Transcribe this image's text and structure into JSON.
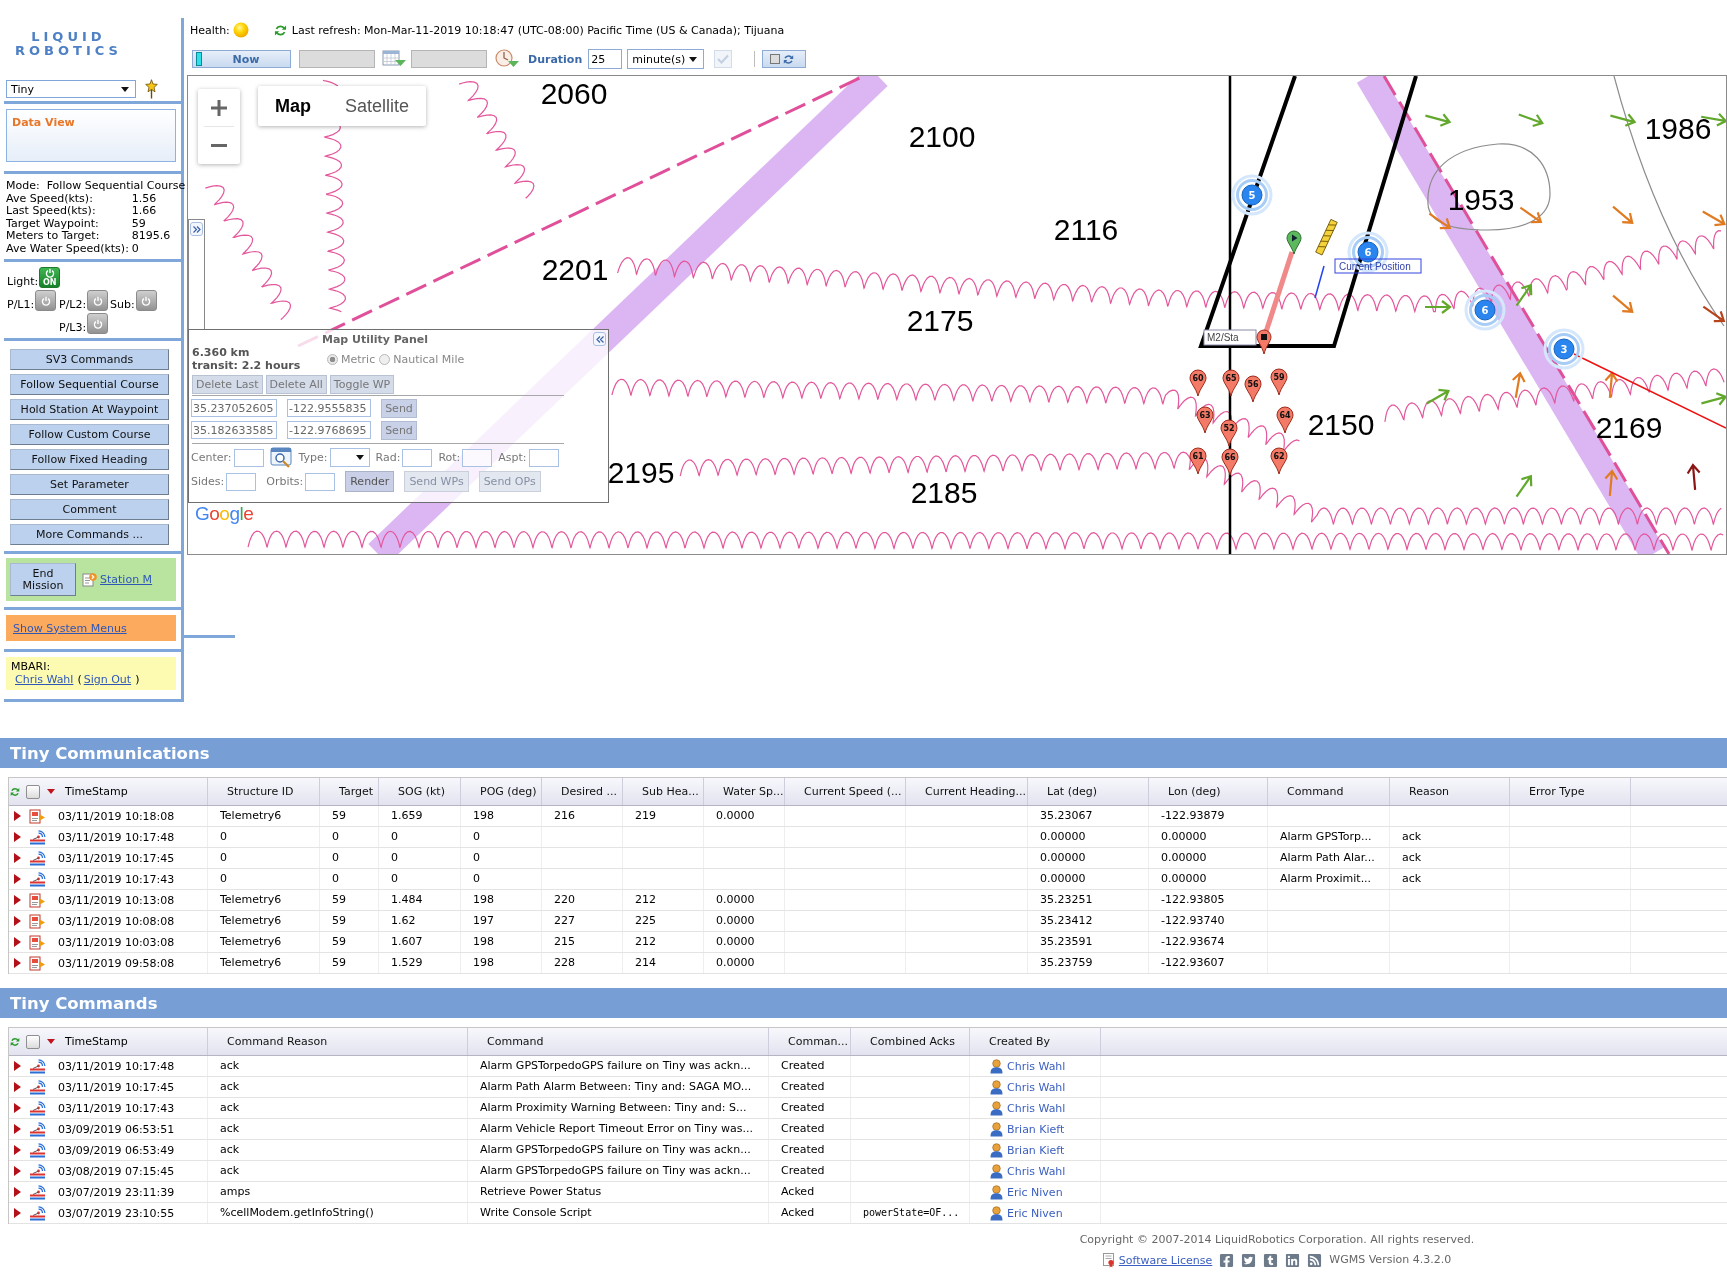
{
  "header": {
    "health_label": "Health:",
    "last_refresh": "Last refresh: Mon-Mar-11-2019 10:18:47 (UTC-08:00) Pacific Time (US & Canada); Tijuana"
  },
  "toolbar": {
    "now_button": "Now",
    "duration_label": "Duration",
    "duration_value": "25",
    "duration_unit": "minute(s)",
    "confirm_disabled": true
  },
  "sidebar": {
    "logo": [
      "LIQUID",
      "ROBOTICS"
    ],
    "vehicle": "Tiny",
    "data_view_title": "Data View",
    "mode": {
      "label": "Mode:",
      "value": "Follow Sequential Course"
    },
    "stats": [
      {
        "label": "Ave Speed(kts):",
        "value": "1.56"
      },
      {
        "label": "Last Speed(kts):",
        "value": "1.66"
      },
      {
        "label": "Target Waypoint:",
        "value": "59"
      },
      {
        "label": "Meters to Target:",
        "value": "8195.6"
      },
      {
        "label": "Ave Water Speed(kts):",
        "value": "0"
      }
    ],
    "power": [
      [
        {
          "label": "Light:",
          "on": true,
          "badge": "ON"
        }
      ],
      [
        {
          "label": "P/L1:",
          "on": false
        },
        {
          "label": "P/L2:",
          "on": false
        },
        {
          "label": "Sub:",
          "on": false
        }
      ],
      [
        {
          "label": "P/L3:",
          "on": false
        }
      ]
    ],
    "commands": [
      "SV3 Commands",
      "Follow Sequential Course",
      "Hold Station At Waypoint",
      "Follow Custom Course",
      "Follow Fixed Heading",
      "Set Parameter",
      "Comment",
      "More Commands ..."
    ],
    "end_mission": "End Mission",
    "mission_link": "Station M",
    "system_menus_link": "Show System Menus",
    "account": {
      "org": "MBARI:",
      "user_link": "Chris Wahl",
      "open_paren": "(",
      "sign_out_link": "Sign Out",
      "close_paren": ")"
    }
  },
  "map": {
    "map_types": [
      {
        "label": "Map",
        "selected": true
      },
      {
        "label": "Satellite",
        "selected": false
      }
    ],
    "depth_labels": [
      "2060",
      "1986",
      "2100",
      "1953",
      "2116",
      "2201",
      "2175",
      "2150",
      "2169",
      "2195",
      "2185"
    ],
    "position_markers": [
      "5",
      "6",
      "6",
      "3"
    ],
    "current_position_label": "Current Position",
    "station_label": "M2/Sta",
    "waypoints": [
      "60",
      "65",
      "56",
      "59",
      "63",
      "52",
      "64",
      "61",
      "66",
      "62"
    ],
    "attribution": "Google"
  },
  "map_utility": {
    "title": "Map Utility Panel",
    "distance": "6.360 km",
    "transit": "transit: 2.2 hours",
    "units": [
      {
        "label": "Metric",
        "selected": true
      },
      {
        "label": "Nautical Mile",
        "selected": false
      }
    ],
    "actions": [
      "Delete Last",
      "Delete All",
      "Toggle WP"
    ],
    "points": [
      {
        "lat": "35.237052605",
        "lon": "-122.9555835",
        "send": "Send"
      },
      {
        "lat": "35.182633585",
        "lon": "-122.9768695",
        "send": "Send"
      }
    ],
    "shape_rows": [
      [
        {
          "kind": "input",
          "label": "Center:"
        },
        {
          "kind": "picker"
        },
        {
          "kind": "select",
          "label": "Type:"
        },
        {
          "kind": "input",
          "label": "Rad:"
        },
        {
          "kind": "input",
          "label": "Rot:"
        },
        {
          "kind": "input",
          "label": "Aspt:"
        }
      ],
      [
        {
          "kind": "input",
          "label": "Sides:"
        },
        {
          "kind": "input",
          "label": "Orbits:"
        },
        {
          "kind": "button",
          "label": "Render",
          "disabled": false
        },
        {
          "kind": "button",
          "label": "Send WPs",
          "disabled": true
        },
        {
          "kind": "button",
          "label": "Send OPs",
          "disabled": true
        }
      ]
    ]
  },
  "communications": {
    "title": "Tiny Communications",
    "select_all_checked": false,
    "columns": [
      "TimeStamp",
      "Structure ID",
      "Target",
      "SOG (kt)",
      "POG (deg)",
      "Desired ...",
      "Sub Hea...",
      "Water Sp...",
      "Current Speed (...",
      "Current Heading...",
      "Lat (deg)",
      "Lon (deg)",
      "Command",
      "Reason",
      "Error Type"
    ],
    "rows": [
      {
        "kind": "telemetry",
        "cells": [
          "03/11/2019 10:18:08",
          "Telemetry6",
          "59",
          "1.659",
          "198",
          "216",
          "219",
          "0.0000",
          null,
          null,
          "35.23067",
          "-122.93879",
          null,
          null,
          null
        ]
      },
      {
        "kind": "command",
        "cells": [
          "03/11/2019 10:17:48",
          "0",
          "0",
          "0",
          "0",
          null,
          null,
          null,
          null,
          null,
          "0.00000",
          "0.00000",
          "Alarm GPSTorp...",
          "ack",
          null
        ]
      },
      {
        "kind": "command",
        "cells": [
          "03/11/2019 10:17:45",
          "0",
          "0",
          "0",
          "0",
          null,
          null,
          null,
          null,
          null,
          "0.00000",
          "0.00000",
          "Alarm Path Alar...",
          "ack",
          null
        ]
      },
      {
        "kind": "command",
        "cells": [
          "03/11/2019 10:17:43",
          "0",
          "0",
          "0",
          "0",
          null,
          null,
          null,
          null,
          null,
          "0.00000",
          "0.00000",
          "Alarm Proximit...",
          "ack",
          null
        ]
      },
      {
        "kind": "telemetry",
        "cells": [
          "03/11/2019 10:13:08",
          "Telemetry6",
          "59",
          "1.484",
          "198",
          "220",
          "212",
          "0.0000",
          null,
          null,
          "35.23251",
          "-122.93805",
          null,
          null,
          null
        ]
      },
      {
        "kind": "telemetry",
        "cells": [
          "03/11/2019 10:08:08",
          "Telemetry6",
          "59",
          "1.62",
          "197",
          "227",
          "225",
          "0.0000",
          null,
          null,
          "35.23412",
          "-122.93740",
          null,
          null,
          null
        ]
      },
      {
        "kind": "telemetry",
        "cells": [
          "03/11/2019 10:03:08",
          "Telemetry6",
          "59",
          "1.607",
          "198",
          "215",
          "212",
          "0.0000",
          null,
          null,
          "35.23591",
          "-122.93674",
          null,
          null,
          null
        ]
      },
      {
        "kind": "telemetry",
        "cells": [
          "03/11/2019 09:58:08",
          "Telemetry6",
          "59",
          "1.529",
          "198",
          "228",
          "214",
          "0.0000",
          null,
          null,
          "35.23759",
          "-122.93607",
          null,
          null,
          null
        ]
      }
    ]
  },
  "commands": {
    "title": "Tiny Commands",
    "select_all_checked": false,
    "columns": [
      "TimeStamp",
      "Command Reason",
      "Command",
      "Comman...",
      "Combined Acks",
      "Created By"
    ],
    "rows": [
      {
        "kind": "command",
        "cells": [
          "03/11/2019 10:17:48",
          "ack",
          "Alarm GPSTorpedoGPS failure on Tiny was ackn...",
          "Created",
          null
        ],
        "created_by": "Chris Wahl"
      },
      {
        "kind": "command",
        "cells": [
          "03/11/2019 10:17:45",
          "ack",
          "Alarm Path Alarm Between: Tiny and: SAGA MO...",
          "Created",
          null
        ],
        "created_by": "Chris Wahl"
      },
      {
        "kind": "command",
        "cells": [
          "03/11/2019 10:17:43",
          "ack",
          "Alarm Proximity Warning Between: Tiny and: S...",
          "Created",
          null
        ],
        "created_by": "Chris Wahl"
      },
      {
        "kind": "command",
        "cells": [
          "03/09/2019 06:53:51",
          "ack",
          "Alarm Vehicle Report Timeout Error on Tiny was...",
          "Created",
          null
        ],
        "created_by": "Brian Kieft"
      },
      {
        "kind": "command",
        "cells": [
          "03/09/2019 06:53:49",
          "ack",
          "Alarm GPSTorpedoGPS failure on Tiny was ackn...",
          "Created",
          null
        ],
        "created_by": "Brian Kieft"
      },
      {
        "kind": "command",
        "cells": [
          "03/08/2019 07:15:45",
          "ack",
          "Alarm GPSTorpedoGPS failure on Tiny was ackn...",
          "Created",
          null
        ],
        "created_by": "Chris Wahl"
      },
      {
        "kind": "command",
        "cells": [
          "03/07/2019 23:11:39",
          "amps",
          "Retrieve Power Status",
          "Acked",
          null
        ],
        "created_by": "Eric Niven"
      },
      {
        "kind": "command",
        "cells": [
          "03/07/2019 23:10:55",
          "%cellModem.getInfoString()",
          "Write Console Script",
          "Acked",
          "powerState=OF..."
        ],
        "created_by": "Eric Niven"
      }
    ]
  },
  "footer": {
    "copyright": "Copyright © 2007-2014 LiquidRobotics Corporation. All rights reserved.",
    "license_link": "Software License",
    "version": "WGMS Version 4.3.2.0"
  }
}
